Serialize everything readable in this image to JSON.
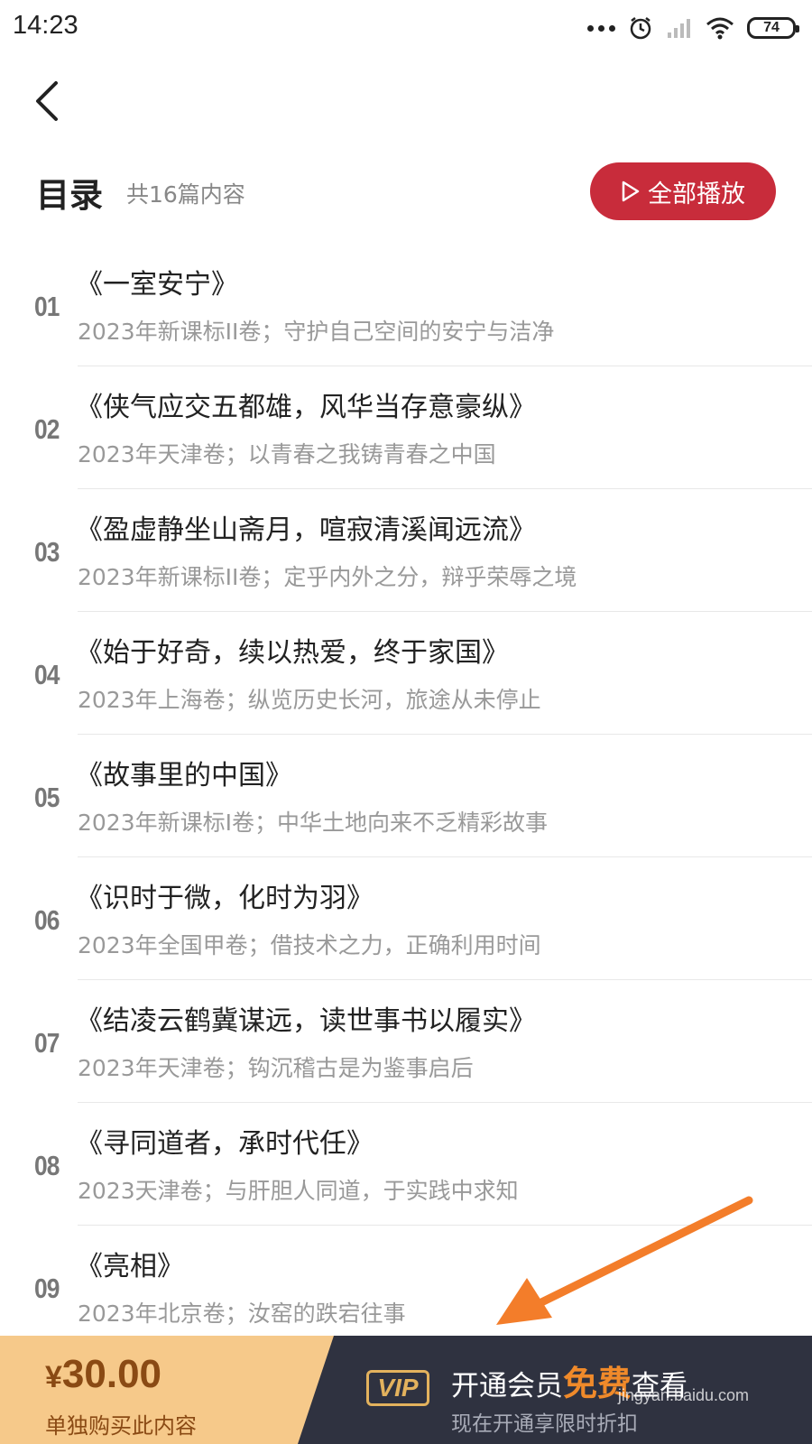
{
  "status_bar": {
    "time": "14:23",
    "battery": "74"
  },
  "header": {
    "title": "目录",
    "count": "共16篇内容",
    "play_all_label": "全部播放"
  },
  "items": [
    {
      "num": "01",
      "title": "《一室安宁》",
      "desc": "2023年新课标II卷；守护自己空间的安宁与洁净"
    },
    {
      "num": "02",
      "title": "《侠气应交五都雄，风华当存意豪纵》",
      "desc": "2023年天津卷；以青春之我铸青春之中国"
    },
    {
      "num": "03",
      "title": "《盈虚静坐山斋月，喧寂清溪闻远流》",
      "desc": "2023年新课标II卷；定乎内外之分，辩乎荣辱之境"
    },
    {
      "num": "04",
      "title": "《始于好奇，续以热爱，终于家国》",
      "desc": "2023年上海卷；纵览历史长河，旅途从未停止"
    },
    {
      "num": "05",
      "title": "《故事里的中国》",
      "desc": "2023年新课标I卷；中华土地向来不乏精彩故事"
    },
    {
      "num": "06",
      "title": "《识时于微，化时为羽》",
      "desc": "2023年全国甲卷；借技术之力，正确利用时间"
    },
    {
      "num": "07",
      "title": "《结凌云鹤冀谋远，读世事书以履实》",
      "desc": "2023年天津卷；钩沉稽古是为鉴事启后"
    },
    {
      "num": "08",
      "title": "《寻同道者，承时代任》",
      "desc": "2023天津卷；与肝胆人同道，于实践中求知"
    },
    {
      "num": "09",
      "title": "《亮相》",
      "desc": "2023年北京卷；汝窑的跌宕往事"
    }
  ],
  "bottom": {
    "currency": "¥",
    "price": "30.00",
    "price_sub": "单独购买此内容",
    "vip_badge": "VIP",
    "vip_prefix": "开通会员",
    "vip_free": "免费",
    "vip_suffix": "查看",
    "vip_sub": "现在开通享限时折扣",
    "watermark": "jingyan.baidu.com"
  },
  "colors": {
    "accent_red": "#c82c3b",
    "bar_gold": "#f6c98a",
    "vip_dark": "#2f3240",
    "arrow_orange": "#f37d2a"
  }
}
